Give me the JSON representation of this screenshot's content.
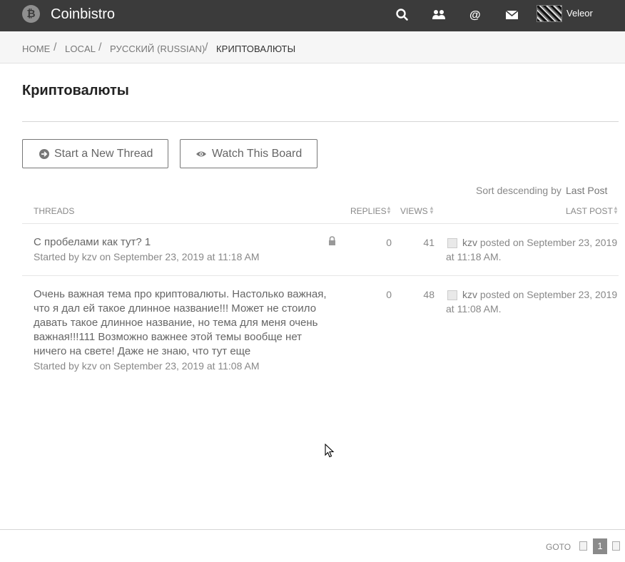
{
  "app": {
    "brand_logo_glyph": "₿",
    "brand_name": "Coinbistro",
    "username": "Veleor"
  },
  "nav_icons": [
    "search-icon",
    "users-icon",
    "at-icon",
    "envelope-icon"
  ],
  "breadcrumb": [
    {
      "label": "Home"
    },
    {
      "label": "Local"
    },
    {
      "label": "Русский (Russian)"
    },
    {
      "label": "Криптовалюты"
    }
  ],
  "page": {
    "title": "Криптовалюты"
  },
  "actions": {
    "new_thread": "Start a New Thread",
    "watch_board": "Watch This Board"
  },
  "sort": {
    "label": "Sort descending by",
    "value": "Last Post"
  },
  "table": {
    "headers": {
      "threads": "Threads",
      "replies": "Replies",
      "views": "Views",
      "last_post": "Last Post"
    },
    "rows": [
      {
        "title": "С пробелами как тут? 1",
        "meta": "Started by kzv on September 23, 2019 at 11:18 AM",
        "locked": true,
        "replies": "0",
        "views": "41",
        "last_post": {
          "author": "kzv",
          "text": "posted on September 23, 2019 at 11:18 AM."
        }
      },
      {
        "title": "Очень важная тема про криптовалюты. Настолько важная, что я дал ей такое длинное название!!! Может не стоило давать такое длинное название, но тема для меня очень важная!!!111 Возможно важнее этой темы вообще нет ничего на свете! Даже не знаю, что тут еще",
        "meta": "Started by kzv on September 23, 2019 at 11:08 AM",
        "locked": false,
        "replies": "0",
        "views": "48",
        "last_post": {
          "author": "kzv",
          "text": "posted on September 23, 2019 at 11:08 AM."
        }
      }
    ]
  },
  "pagination": {
    "goto_label": "Goto",
    "current_page": "1"
  },
  "colors": {
    "topnav_bg": "#3b3b3b",
    "accent_page": "#8a8a8a"
  }
}
